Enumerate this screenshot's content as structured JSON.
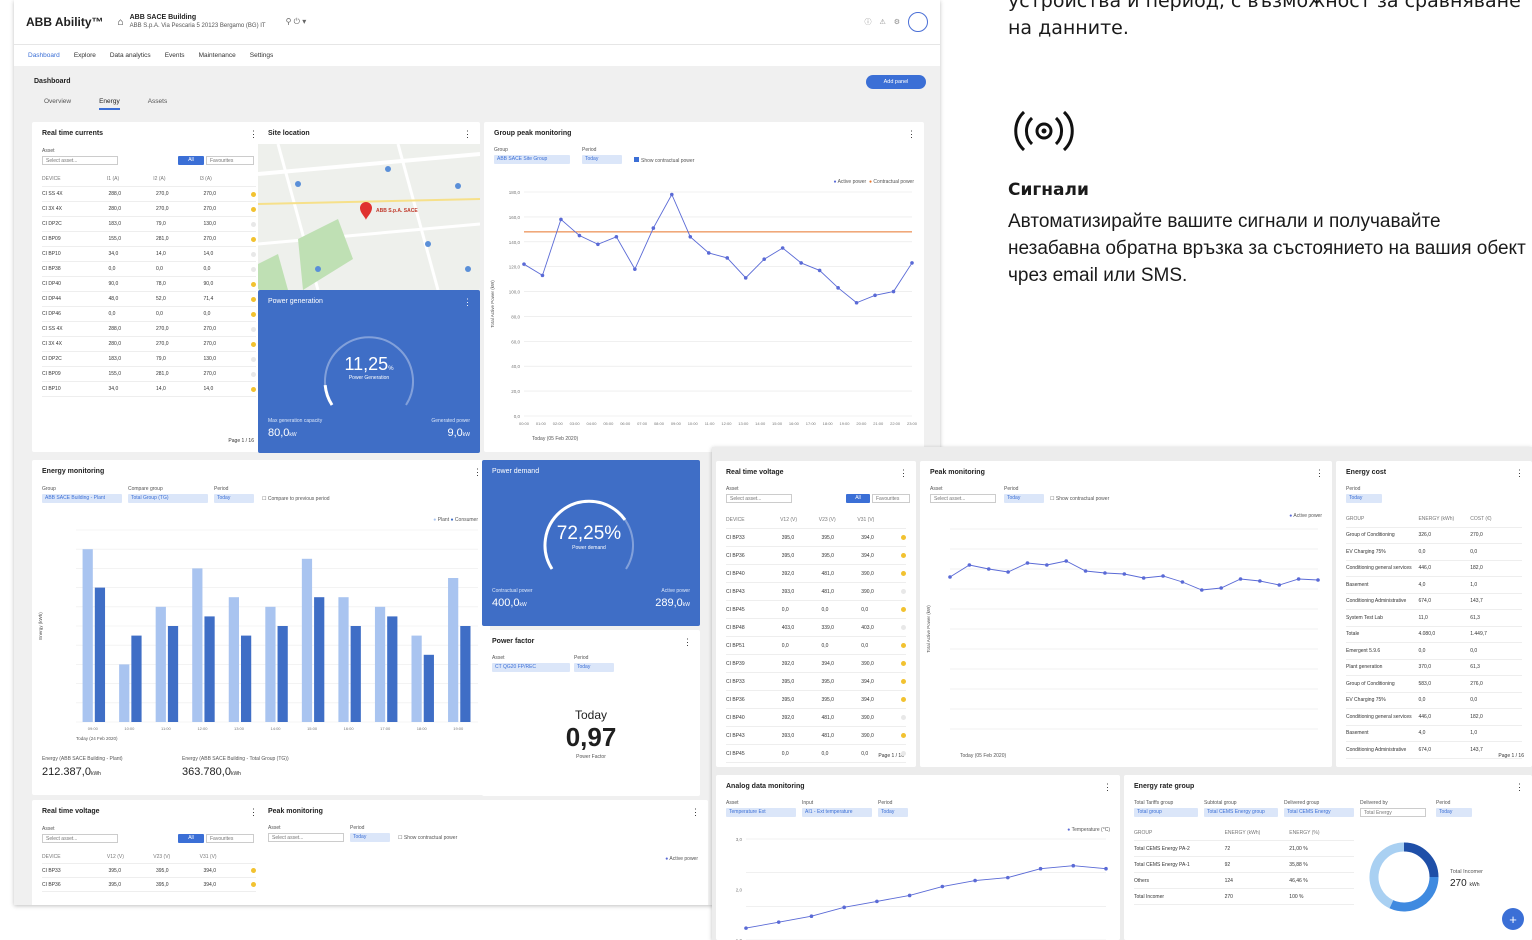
{
  "text_block": {
    "intro": "устройства и период, с възможност за сравняване на данните.",
    "signals_heading": "Сигнали",
    "signals_body": "Автоматизирайте вашите сигнали и получавайте незабавна обратна връзка за състоянието на вашия обект чрез email или SMS."
  },
  "app": {
    "brand": "ABB Ability™",
    "site_name": "ABB SACE Building",
    "site_address": "ABB S.p.A. Via Pescaria 5 20123 Bergamo (BG) IT",
    "nav": [
      "Dashboard",
      "Explore",
      "Data analytics",
      "Events",
      "Maintenance",
      "Settings"
    ],
    "page_title": "Dashboard",
    "add_panel": "Add panel",
    "tabs": [
      "Overview",
      "Energy",
      "Assets"
    ]
  },
  "real_time_currents": {
    "title": "Real time currents",
    "asset_label": "Asset",
    "asset_placeholder": "Select asset...",
    "toggle_on": "All",
    "toggle_off": "Favourites",
    "headers": [
      "DEVICE",
      "I1 (A)",
      "I2 (A)",
      "I3 (A)"
    ],
    "rows": [
      [
        "CI SS 4X",
        "288,0",
        "270,0",
        "270,0"
      ],
      [
        "CI 3X 4X",
        "280,0",
        "270,0",
        "270,0"
      ],
      [
        "CI DP2C",
        "183,0",
        "79,0",
        "130,0"
      ],
      [
        "CI BP09",
        "155,0",
        "281,0",
        "270,0"
      ],
      [
        "CI BP10",
        "34,0",
        "14,0",
        "14,0"
      ],
      [
        "CI BP38",
        "0,0",
        "0,0",
        "0,0"
      ],
      [
        "CI DP40",
        "90,0",
        "78,0",
        "90,0"
      ],
      [
        "CI DP44",
        "48,0",
        "52,0",
        "71,4"
      ],
      [
        "CI DP46",
        "0,0",
        "0,0",
        "0,0"
      ],
      [
        "CI SS 4X",
        "288,0",
        "270,0",
        "270,0"
      ],
      [
        "CI 3X 4X",
        "280,0",
        "270,0",
        "270,0"
      ],
      [
        "CI DP2C",
        "183,0",
        "79,0",
        "130,0"
      ],
      [
        "CI BP09",
        "155,0",
        "281,0",
        "270,0"
      ],
      [
        "CI BP10",
        "34,0",
        "14,0",
        "14,0"
      ]
    ],
    "page": "Page 1 / 16"
  },
  "site_location": {
    "title": "Site location",
    "marker": "ABB S.p.A. SACE"
  },
  "power_generation": {
    "title": "Power generation",
    "value": "11,25",
    "unit": "%",
    "sub": "Power Generation",
    "left_label": "Max generation capacity",
    "left_value": "80,0",
    "left_unit": "kW",
    "right_label": "Generated power",
    "right_value": "9,0",
    "right_unit": "kW",
    "fraction": 0.1125
  },
  "group_peak": {
    "title": "Group peak monitoring",
    "group_label": "Group",
    "group_value": "ABB SACE Site Group",
    "period_label": "Period",
    "period_value": "Today",
    "checkbox": "Show contractual power",
    "legend": [
      "Active power",
      "Contractual power"
    ],
    "ylabel": "Total Active Power (kW)",
    "date": "Today (05 Feb 2020)"
  },
  "energy_monitoring": {
    "title": "Energy monitoring",
    "group_label": "Group",
    "compare_label": "Compare group",
    "period_label": "Period",
    "group_value": "ABB SACE Building - Plant",
    "compare_value": "Total Group (TG)",
    "period_value": "Today",
    "checkbox": "Compare to previous period",
    "legend": [
      "Plant",
      "Consumer"
    ],
    "ylabel": "Energy (kWh)",
    "date": "Today (24 Feb 2020)",
    "total1_label": "Energy (ABB SACE Building - Plant)",
    "total1": "212.387,0",
    "total1_unit": "kWh",
    "total2_label": "Energy (ABB SACE Building - Total Group (TG))",
    "total2": "363.780,0",
    "total2_unit": "kWh"
  },
  "power_demand": {
    "title": "Power demand",
    "value": "72,25%",
    "sub": "Power demand",
    "left_label": "Contractual power",
    "left_value": "400,0",
    "left_unit": "kW",
    "right_label": "Active power",
    "right_value": "289,0",
    "right_unit": "kW",
    "fraction": 0.7225
  },
  "power_factor": {
    "title": "Power factor",
    "asset_label": "Asset",
    "asset_value": "CT QG20 FP/REC",
    "period_label": "Period",
    "period_value": "Today",
    "day": "Today",
    "value": "0,97",
    "sub": "Power Factor"
  },
  "rtv_bottom": {
    "title": "Real time voltage",
    "asset_label": "Asset",
    "asset_placeholder": "Select asset...",
    "toggle_on": "All",
    "toggle_off": "Favourites",
    "headers": [
      "DEVICE",
      "V12 (V)",
      "V23 (V)",
      "V31 (V)"
    ],
    "rows": [
      [
        "CI BP33",
        "395,0",
        "395,0",
        "394,0"
      ],
      [
        "CI BP36",
        "395,0",
        "395,0",
        "394,0"
      ]
    ]
  },
  "peak_bottom": {
    "title": "Peak monitoring",
    "asset_label": "Asset",
    "asset_placeholder": "Select asset...",
    "period_label": "Period",
    "period_value": "Today",
    "checkbox": "Show contractual power",
    "legend": "Active power"
  },
  "rtv_right": {
    "title": "Real time voltage",
    "asset_label": "Asset",
    "asset_placeholder": "Select asset...",
    "toggle_on": "All",
    "toggle_off": "Favourites",
    "headers": [
      "DEVICE",
      "V12 (V)",
      "V23 (V)",
      "V31 (V)"
    ],
    "rows": [
      [
        "CI BP33",
        "395,0",
        "395,0",
        "394,0"
      ],
      [
        "CI BP36",
        "395,0",
        "395,0",
        "394,0"
      ],
      [
        "CI BP40",
        "392,0",
        "481,0",
        "390,0"
      ],
      [
        "CI BP43",
        "393,0",
        "481,0",
        "390,0"
      ],
      [
        "CI BP45",
        "0,0",
        "0,0",
        "0,0"
      ],
      [
        "CI BP48",
        "403,0",
        "339,0",
        "403,0"
      ],
      [
        "CI BP51",
        "0,0",
        "0,0",
        "0,0"
      ],
      [
        "CI BP39",
        "392,0",
        "394,0",
        "390,0"
      ],
      [
        "CI BP33",
        "395,0",
        "395,0",
        "394,0"
      ],
      [
        "CI BP36",
        "395,0",
        "395,0",
        "394,0"
      ],
      [
        "CI BP40",
        "392,0",
        "481,0",
        "390,0"
      ],
      [
        "CI BP43",
        "393,0",
        "481,0",
        "390,0"
      ],
      [
        "CI BP45",
        "0,0",
        "0,0",
        "0,0"
      ]
    ],
    "page": "Page 1 / 16"
  },
  "peak_right": {
    "title": "Peak monitoring",
    "asset_label": "Asset",
    "asset_placeholder": "Select asset...",
    "period_label": "Period",
    "period_value": "Today",
    "checkbox": "Show contractual power",
    "legend": "Active power",
    "ylabel": "Total Active Power (kW)",
    "date": "Today (05 Feb 2020)"
  },
  "energy_cost": {
    "title": "Energy cost",
    "period_label": "Period",
    "period_value": "Today",
    "headers": [
      "GROUP",
      "ENERGY (kWh)",
      "COST (€)"
    ],
    "rows": [
      [
        "Group of Conditioning",
        "326,0",
        "270,0"
      ],
      [
        "EV Charging 75%",
        "0,0",
        "0,0"
      ],
      [
        "Conditioning general services",
        "446,0",
        "182,0"
      ],
      [
        "Basement",
        "4,0",
        "1,0"
      ],
      [
        "Conditioning Administrative",
        "674,0",
        "143,7"
      ],
      [
        "System Test Lab",
        "11,0",
        "61,3"
      ],
      [
        "Totale",
        "4.080,0",
        "1.449,7"
      ],
      [
        "Emergent 5.9.6",
        "0,0",
        "0,0"
      ],
      [
        "Plant generation",
        "370,0",
        "61,3"
      ],
      [
        "Group of Conditioning",
        "583,0",
        "276,0"
      ],
      [
        "EV Charging 75%",
        "0,0",
        "0,0"
      ],
      [
        "Conditioning general services",
        "446,0",
        "182,0"
      ],
      [
        "Basement",
        "4,0",
        "1,0"
      ],
      [
        "Conditioning Administrative",
        "674,0",
        "143,7"
      ]
    ],
    "page": "Page 1 / 16"
  },
  "analog": {
    "title": "Analog data monitoring",
    "asset_label": "Asset",
    "asset_value": "Temperature Ext",
    "input_label": "Input",
    "input_value": "AI1 - Ext temperature",
    "period_label": "Period",
    "period_value": "Today",
    "legend": "Temperature (°C)",
    "yticks": [
      "3,0",
      "2,0",
      "1,0"
    ]
  },
  "ratio": {
    "title": "Energy rate group",
    "f1": "Total Tariffs group",
    "f2": "Subtotal group",
    "f3": "Delivered group",
    "f4": "Delivered by",
    "f5": "Period",
    "v1": "Total group",
    "v2": "Total CEMS Energy group",
    "v3": "Total CEMS Energy",
    "v4": "Total Energy",
    "v5": "Today",
    "headers": [
      "GROUP",
      "ENERGY (kWh)",
      "ENERGY (%)"
    ],
    "rows": [
      [
        "Total CEMS Energy PA-2",
        "72",
        "21,00 %"
      ],
      [
        "Total CEMS Energy PA-1",
        "92",
        "35,88 %"
      ],
      [
        "Others",
        "124",
        "46,46 %"
      ],
      [
        "Total Incomer",
        "270",
        "100 %"
      ]
    ],
    "donut_label": "Total Incomer",
    "donut_value": "270",
    "donut_unit": "kWh"
  },
  "chart_data": [
    {
      "type": "line",
      "title": "Group peak monitoring",
      "ylabel": "Total Active Power (kW)",
      "x": [
        "00:00",
        "01:00",
        "02:00",
        "03:00",
        "04:00",
        "05:00",
        "06:00",
        "07:00",
        "08:00",
        "09:00",
        "10:00",
        "11:00",
        "12:00",
        "13:00",
        "14:00",
        "15:00",
        "16:00",
        "17:00",
        "18:00",
        "19:00",
        "20:00",
        "21:00",
        "22:00",
        "23:00"
      ],
      "series": [
        {
          "name": "Active power",
          "values": [
            122,
            113,
            158,
            145,
            138,
            144,
            118,
            151,
            178,
            144,
            131,
            127,
            111,
            126,
            135,
            123,
            117,
            103,
            91,
            97,
            100,
            123
          ]
        },
        {
          "name": "Contractual power",
          "values": [
            148,
            148,
            148,
            148,
            148,
            148,
            148,
            148,
            148,
            148,
            148,
            148,
            148,
            148,
            148,
            148,
            148,
            148,
            148,
            148,
            148,
            148
          ]
        }
      ],
      "yticks": [
        "180,0",
        "160,0",
        "140,0",
        "120,0",
        "100,0",
        "80,0",
        "60,0",
        "40,0",
        "20,0",
        "0,0"
      ],
      "ylim": [
        0,
        180
      ]
    },
    {
      "type": "bar",
      "title": "Energy monitoring",
      "ylabel": "Energy (kWh)",
      "categories": [
        "09:00",
        "10:00",
        "11:00",
        "12:00",
        "13:00",
        "14:00",
        "15:00",
        "16:00",
        "17:00",
        "18:00",
        "19:00"
      ],
      "series": [
        {
          "name": "Plant",
          "values": [
            18,
            6,
            12,
            16,
            13,
            12,
            17,
            13,
            12,
            9,
            15
          ]
        },
        {
          "name": "Consumer",
          "values": [
            14,
            9,
            10,
            11,
            9,
            10,
            13,
            10,
            11,
            7,
            10
          ]
        }
      ],
      "ylim": [
        0,
        20
      ]
    },
    {
      "type": "line",
      "title": "Peak monitoring",
      "ylabel": "Total Active Power (kW)",
      "series": [
        {
          "name": "Active power",
          "values": [
            152,
            164,
            160,
            157,
            166,
            164,
            168,
            158,
            156,
            155,
            151,
            153,
            147,
            139,
            141,
            150,
            148,
            144,
            150,
            149
          ]
        }
      ]
    },
    {
      "type": "line",
      "title": "Analog data monitoring",
      "series": [
        {
          "name": "Temperature (°C)",
          "values": [
            0.2,
            0.4,
            0.6,
            0.9,
            1.1,
            1.3,
            1.6,
            1.8,
            1.9,
            2.2,
            2.3,
            2.2
          ]
        }
      ]
    },
    {
      "type": "pie",
      "title": "Energy rate group",
      "categories": [
        "Total CEMS Energy PA-2",
        "Total CEMS Energy PA-1",
        "Others"
      ],
      "values": [
        72,
        92,
        124
      ]
    }
  ]
}
